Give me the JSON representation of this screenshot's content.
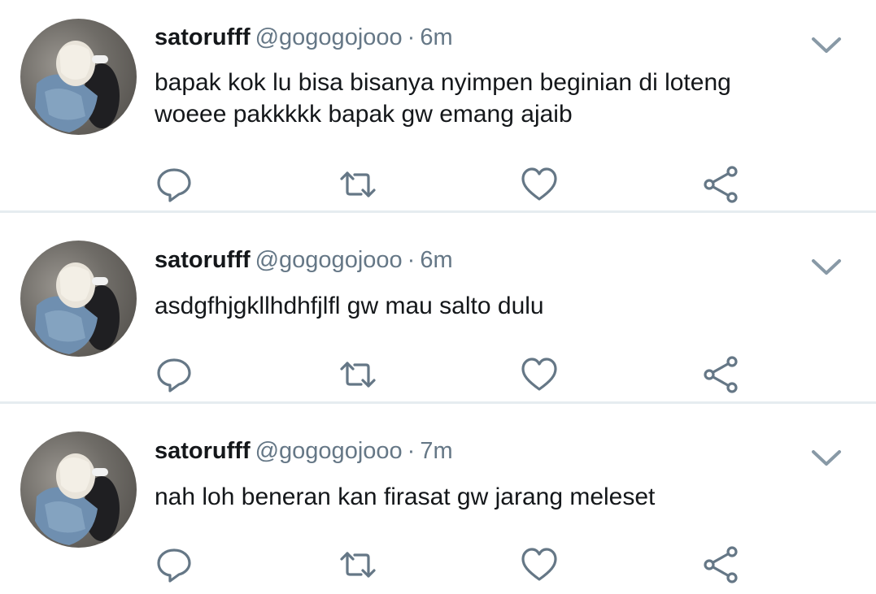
{
  "colors": {
    "name": "#14171a",
    "meta": "#657786",
    "icon": "#657786",
    "divider": "#e6ecf0"
  },
  "tweets": [
    {
      "name": "satorufff",
      "handle": "@gogogojooo",
      "separator": "·",
      "time": "6m",
      "lines": [
        "bapak kok lu bisa bisanya nyimpen beginian di loteng",
        "woeee pakkkkk bapak gw emang ajaib"
      ],
      "icons": [
        "reply-icon",
        "retweet-icon",
        "like-icon",
        "share-icon",
        "chevron-down-icon"
      ]
    },
    {
      "name": "satorufff",
      "handle": "@gogogojooo",
      "separator": "·",
      "time": "6m",
      "lines": [
        "asdgfhjgkllhdhfjlfl gw mau salto dulu"
      ],
      "icons": [
        "reply-icon",
        "retweet-icon",
        "like-icon",
        "share-icon",
        "chevron-down-icon"
      ]
    },
    {
      "name": "satorufff",
      "handle": "@gogogojooo",
      "separator": "·",
      "time": "7m",
      "lines": [
        "nah loh beneran kan firasat gw jarang meleset"
      ],
      "icons": [
        "reply-icon",
        "retweet-icon",
        "like-icon",
        "share-icon",
        "chevron-down-icon"
      ]
    }
  ]
}
